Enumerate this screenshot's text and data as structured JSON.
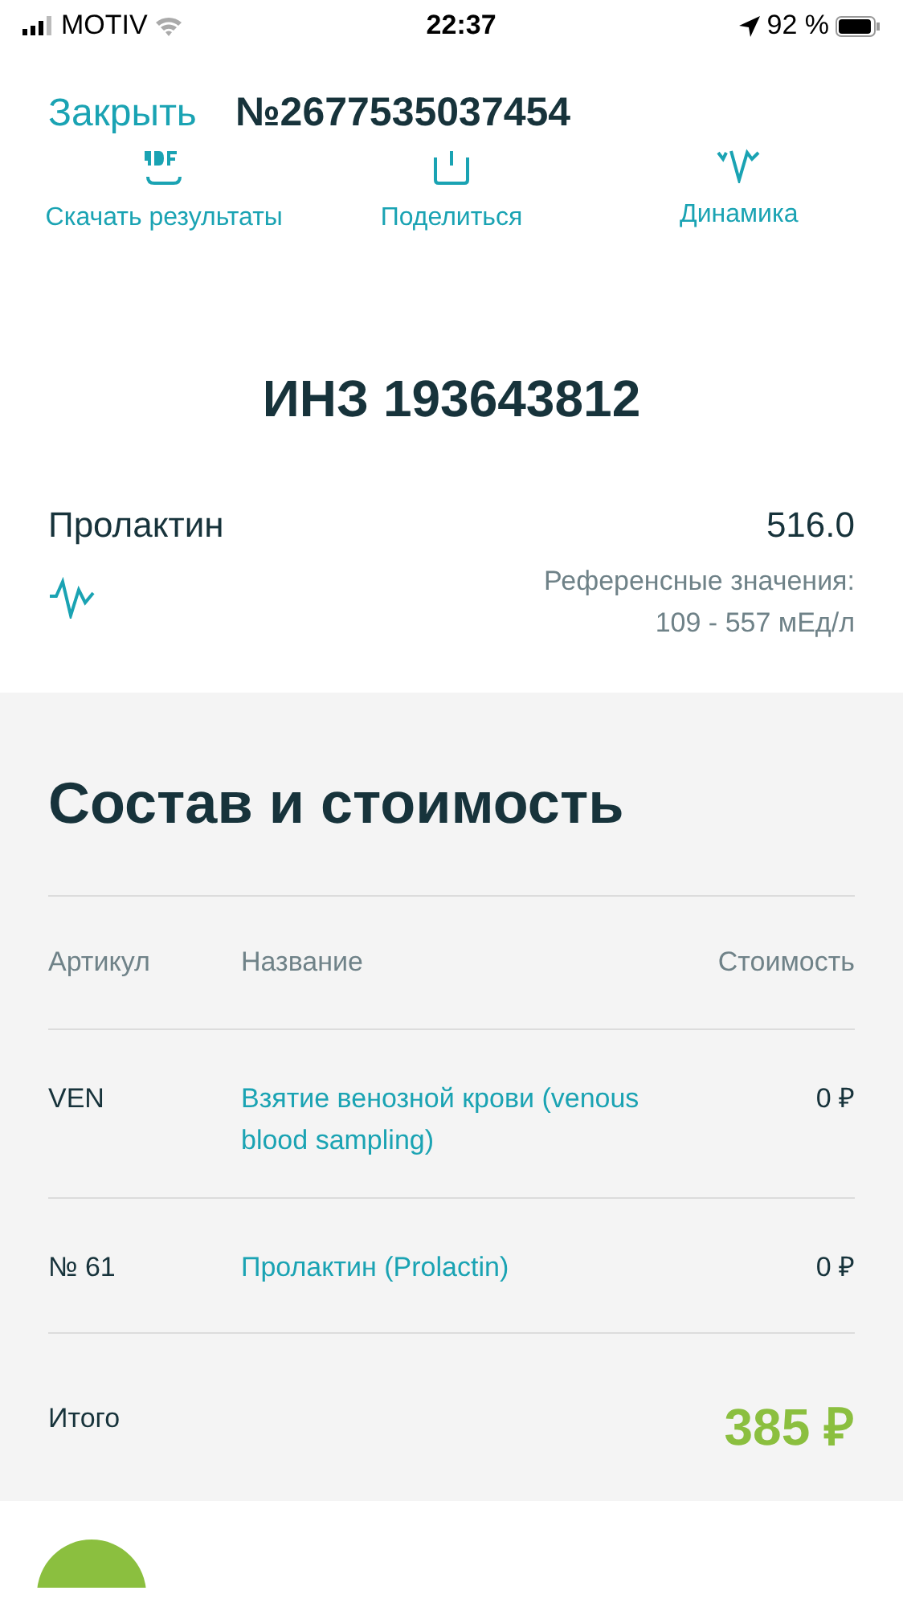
{
  "status_bar": {
    "carrier": "MOTIV",
    "time": "22:37",
    "battery": "92 %"
  },
  "header": {
    "close": "Закрыть",
    "title": "№2677535037454"
  },
  "actions": [
    {
      "kind": "pdf",
      "label": "Скачать результаты"
    },
    {
      "kind": "share",
      "label": "Поделиться"
    },
    {
      "kind": "dynamics",
      "label": "Динамика"
    }
  ],
  "patient_id": "ИНЗ 193643812",
  "result": {
    "name": "Пролактин",
    "value": "516.0",
    "reference_label": "Референсные значения:",
    "reference_range": "109 - 557 мЕд/л"
  },
  "composition": {
    "title": "Состав и стоимость",
    "columns": [
      "Артикул",
      "Название",
      "Стоимость"
    ],
    "rows": [
      {
        "code": "VEN",
        "name": "Взятие венозной крови (venous blood sampling)",
        "price": "0 ₽"
      },
      {
        "code": "№ 61",
        "name": "Пролактин (Prolactin)",
        "price": "0 ₽"
      }
    ],
    "total_label": "Итого",
    "total": "385 ₽"
  }
}
